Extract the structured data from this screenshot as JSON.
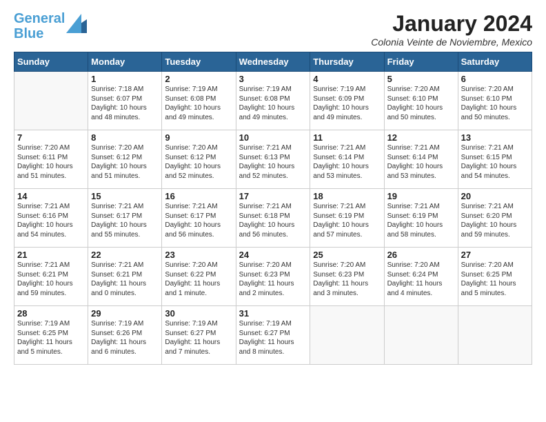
{
  "logo": {
    "line1": "General",
    "line2": "Blue"
  },
  "header": {
    "title": "January 2024",
    "location": "Colonia Veinte de Noviembre, Mexico"
  },
  "days_of_week": [
    "Sunday",
    "Monday",
    "Tuesday",
    "Wednesday",
    "Thursday",
    "Friday",
    "Saturday"
  ],
  "weeks": [
    [
      {
        "day": "",
        "info": ""
      },
      {
        "day": "1",
        "info": "Sunrise: 7:18 AM\nSunset: 6:07 PM\nDaylight: 10 hours\nand 48 minutes."
      },
      {
        "day": "2",
        "info": "Sunrise: 7:19 AM\nSunset: 6:08 PM\nDaylight: 10 hours\nand 49 minutes."
      },
      {
        "day": "3",
        "info": "Sunrise: 7:19 AM\nSunset: 6:08 PM\nDaylight: 10 hours\nand 49 minutes."
      },
      {
        "day": "4",
        "info": "Sunrise: 7:19 AM\nSunset: 6:09 PM\nDaylight: 10 hours\nand 49 minutes."
      },
      {
        "day": "5",
        "info": "Sunrise: 7:20 AM\nSunset: 6:10 PM\nDaylight: 10 hours\nand 50 minutes."
      },
      {
        "day": "6",
        "info": "Sunrise: 7:20 AM\nSunset: 6:10 PM\nDaylight: 10 hours\nand 50 minutes."
      }
    ],
    [
      {
        "day": "7",
        "info": "Sunrise: 7:20 AM\nSunset: 6:11 PM\nDaylight: 10 hours\nand 51 minutes."
      },
      {
        "day": "8",
        "info": "Sunrise: 7:20 AM\nSunset: 6:12 PM\nDaylight: 10 hours\nand 51 minutes."
      },
      {
        "day": "9",
        "info": "Sunrise: 7:20 AM\nSunset: 6:12 PM\nDaylight: 10 hours\nand 52 minutes."
      },
      {
        "day": "10",
        "info": "Sunrise: 7:21 AM\nSunset: 6:13 PM\nDaylight: 10 hours\nand 52 minutes."
      },
      {
        "day": "11",
        "info": "Sunrise: 7:21 AM\nSunset: 6:14 PM\nDaylight: 10 hours\nand 53 minutes."
      },
      {
        "day": "12",
        "info": "Sunrise: 7:21 AM\nSunset: 6:14 PM\nDaylight: 10 hours\nand 53 minutes."
      },
      {
        "day": "13",
        "info": "Sunrise: 7:21 AM\nSunset: 6:15 PM\nDaylight: 10 hours\nand 54 minutes."
      }
    ],
    [
      {
        "day": "14",
        "info": "Sunrise: 7:21 AM\nSunset: 6:16 PM\nDaylight: 10 hours\nand 54 minutes."
      },
      {
        "day": "15",
        "info": "Sunrise: 7:21 AM\nSunset: 6:17 PM\nDaylight: 10 hours\nand 55 minutes."
      },
      {
        "day": "16",
        "info": "Sunrise: 7:21 AM\nSunset: 6:17 PM\nDaylight: 10 hours\nand 56 minutes."
      },
      {
        "day": "17",
        "info": "Sunrise: 7:21 AM\nSunset: 6:18 PM\nDaylight: 10 hours\nand 56 minutes."
      },
      {
        "day": "18",
        "info": "Sunrise: 7:21 AM\nSunset: 6:19 PM\nDaylight: 10 hours\nand 57 minutes."
      },
      {
        "day": "19",
        "info": "Sunrise: 7:21 AM\nSunset: 6:19 PM\nDaylight: 10 hours\nand 58 minutes."
      },
      {
        "day": "20",
        "info": "Sunrise: 7:21 AM\nSunset: 6:20 PM\nDaylight: 10 hours\nand 59 minutes."
      }
    ],
    [
      {
        "day": "21",
        "info": "Sunrise: 7:21 AM\nSunset: 6:21 PM\nDaylight: 10 hours\nand 59 minutes."
      },
      {
        "day": "22",
        "info": "Sunrise: 7:21 AM\nSunset: 6:21 PM\nDaylight: 11 hours\nand 0 minutes."
      },
      {
        "day": "23",
        "info": "Sunrise: 7:20 AM\nSunset: 6:22 PM\nDaylight: 11 hours\nand 1 minute."
      },
      {
        "day": "24",
        "info": "Sunrise: 7:20 AM\nSunset: 6:23 PM\nDaylight: 11 hours\nand 2 minutes."
      },
      {
        "day": "25",
        "info": "Sunrise: 7:20 AM\nSunset: 6:23 PM\nDaylight: 11 hours\nand 3 minutes."
      },
      {
        "day": "26",
        "info": "Sunrise: 7:20 AM\nSunset: 6:24 PM\nDaylight: 11 hours\nand 4 minutes."
      },
      {
        "day": "27",
        "info": "Sunrise: 7:20 AM\nSunset: 6:25 PM\nDaylight: 11 hours\nand 5 minutes."
      }
    ],
    [
      {
        "day": "28",
        "info": "Sunrise: 7:19 AM\nSunset: 6:25 PM\nDaylight: 11 hours\nand 5 minutes."
      },
      {
        "day": "29",
        "info": "Sunrise: 7:19 AM\nSunset: 6:26 PM\nDaylight: 11 hours\nand 6 minutes."
      },
      {
        "day": "30",
        "info": "Sunrise: 7:19 AM\nSunset: 6:27 PM\nDaylight: 11 hours\nand 7 minutes."
      },
      {
        "day": "31",
        "info": "Sunrise: 7:19 AM\nSunset: 6:27 PM\nDaylight: 11 hours\nand 8 minutes."
      },
      {
        "day": "",
        "info": ""
      },
      {
        "day": "",
        "info": ""
      },
      {
        "day": "",
        "info": ""
      }
    ]
  ]
}
